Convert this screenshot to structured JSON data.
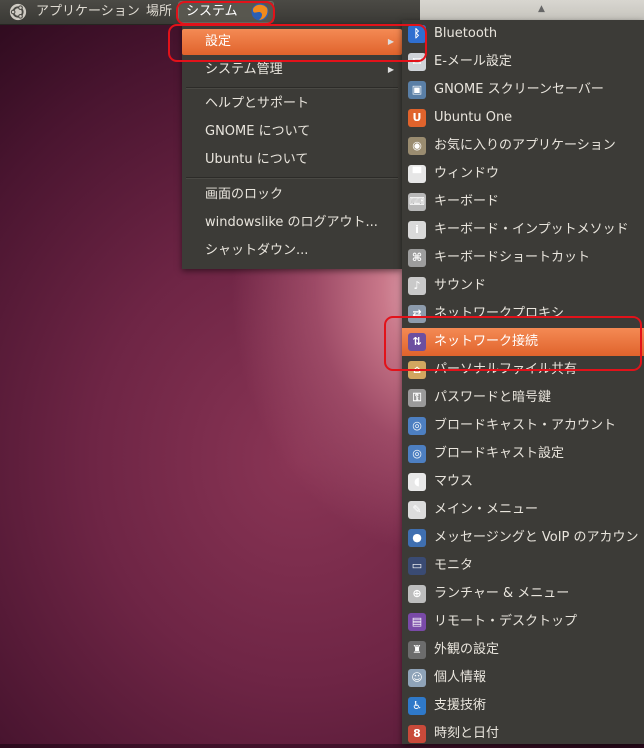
{
  "panel": {
    "applications": "アプリケーション",
    "places": "場所",
    "system": "システム"
  },
  "system_menu": {
    "items": [
      {
        "label": "設定"
      },
      {
        "label": "システム管理"
      },
      {
        "label": "ヘルプとサポート"
      },
      {
        "label": "GNOME について"
      },
      {
        "label": "Ubuntu について"
      },
      {
        "label": "画面のロック"
      },
      {
        "label": "windowslike のログアウト..."
      },
      {
        "label": "シャットダウン..."
      }
    ]
  },
  "settings_menu": {
    "items": [
      {
        "label": "Bluetooth",
        "icon": "bluetooth-icon",
        "color": "#2f6fd0",
        "glyph": "ᛒ"
      },
      {
        "label": "E-メール設定",
        "icon": "email-icon",
        "color": "#cfd3d8",
        "glyph": "✉"
      },
      {
        "label": "GNOME スクリーンセーバー",
        "icon": "screensaver-icon",
        "color": "#5a7fa6",
        "glyph": "▣"
      },
      {
        "label": "Ubuntu One",
        "icon": "ubuntu-one-icon",
        "color": "#e0632c",
        "glyph": "U"
      },
      {
        "label": "お気に入りのアプリケーション",
        "icon": "favorite-apps-icon",
        "color": "#9a8c70",
        "glyph": "◉"
      },
      {
        "label": "ウィンドウ",
        "icon": "window-icon",
        "color": "#e6e6e6",
        "glyph": "▀"
      },
      {
        "label": "キーボード",
        "icon": "keyboard-icon",
        "color": "#b8b8b8",
        "glyph": "⌨"
      },
      {
        "label": "キーボード・インプットメソッド",
        "icon": "input-method-icon",
        "color": "#d9d9d9",
        "glyph": "i"
      },
      {
        "label": "キーボードショートカット",
        "icon": "shortcut-icon",
        "color": "#9d9d9d",
        "glyph": "⌘"
      },
      {
        "label": "サウンド",
        "icon": "sound-icon",
        "color": "#c9c9c9",
        "glyph": "♪"
      },
      {
        "label": "ネットワークプロキシ",
        "icon": "network-proxy-icon",
        "color": "#8d9bac",
        "glyph": "⇄"
      },
      {
        "label": "ネットワーク接続",
        "icon": "network-connections-icon",
        "color": "#6c4fa0",
        "glyph": "⇅"
      },
      {
        "label": "パーソナルファイル共有",
        "icon": "file-sharing-icon",
        "color": "#d2a760",
        "glyph": "⌂"
      },
      {
        "label": "パスワードと暗号鍵",
        "icon": "password-keys-icon",
        "color": "#9a9a9a",
        "glyph": "⚿"
      },
      {
        "label": "ブロードキャスト・アカウント",
        "icon": "broadcast-account-icon",
        "color": "#4d7fc1",
        "glyph": "◎"
      },
      {
        "label": "ブロードキャスト設定",
        "icon": "broadcast-settings-icon",
        "color": "#4d7fc1",
        "glyph": "◎"
      },
      {
        "label": "マウス",
        "icon": "mouse-icon",
        "color": "#e8e8e8",
        "glyph": "◖"
      },
      {
        "label": "メイン・メニュー",
        "icon": "main-menu-icon",
        "color": "#dcdcdc",
        "glyph": "✎"
      },
      {
        "label": "メッセージングと VoIP のアカウン",
        "icon": "messaging-icon",
        "color": "#3f6fb0",
        "glyph": "●"
      },
      {
        "label": "モニタ",
        "icon": "monitor-icon",
        "color": "#3a4b73",
        "glyph": "▭"
      },
      {
        "label": "ランチャー & メニュー",
        "icon": "launcher-icon",
        "color": "#bdbdbd",
        "glyph": "⊕"
      },
      {
        "label": "リモート・デスクトップ",
        "icon": "remote-desktop-icon",
        "color": "#7a4aa8",
        "glyph": "▤"
      },
      {
        "label": "外観の設定",
        "icon": "appearance-icon",
        "color": "#6c6c6c",
        "glyph": "♜"
      },
      {
        "label": "個人情報",
        "icon": "personal-info-icon",
        "color": "#8fa3b8",
        "glyph": "☺"
      },
      {
        "label": "支援技術",
        "icon": "accessibility-icon",
        "color": "#2f79c9",
        "glyph": "♿"
      },
      {
        "label": "時刻と日付",
        "icon": "time-date-icon",
        "color": "#c94a3a",
        "glyph": "8"
      }
    ]
  },
  "colors": {
    "highlight": "#e9672f",
    "annotation_ring": "#e2121a"
  }
}
